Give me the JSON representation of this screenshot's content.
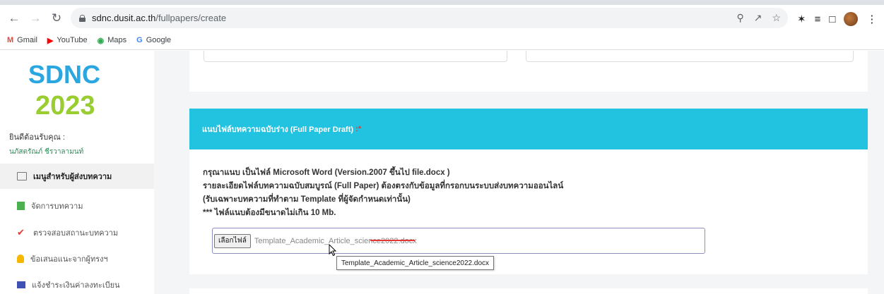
{
  "browser": {
    "url_domain": "sdnc.dusit.ac.th",
    "url_path": "/fullpapers/create",
    "bookmarks": [
      {
        "label": "Gmail",
        "icon": "gmail-icon"
      },
      {
        "label": "YouTube",
        "icon": "youtube-icon"
      },
      {
        "label": "Maps",
        "icon": "maps-icon"
      },
      {
        "label": "Google",
        "icon": "google-icon"
      }
    ]
  },
  "sidebar": {
    "logo_text_top": "SDNC",
    "logo_text_bottom": "2023",
    "welcome": "ยินดีต้อนรับคุณ :",
    "username": "นภัสตรัณภ์ ชีรวาลามนท์",
    "items": [
      {
        "label": "เมนูสำหรับผู้ส่งบทความ",
        "icon": "monitor-icon",
        "active": true
      },
      {
        "label": "จัดการบทความ",
        "icon": "document-icon",
        "active": false
      },
      {
        "label": "ตรวจสอบสถานะบทความ",
        "icon": "check-icon",
        "active": false
      },
      {
        "label": "ข้อเสนอแนะจากผู้ทรงฯ",
        "icon": "person-icon",
        "active": false
      },
      {
        "label": "แจ้งชำระเงินค่าลงทะเบียน",
        "icon": "cart-icon",
        "active": false
      }
    ]
  },
  "form": {
    "header": "แนบไฟล์บทความฉบับร่าง (Full Paper Draft)",
    "required_mark": ":*",
    "instructions": [
      "กรุณาแนบ เป็นไฟล์ Microsoft Word (Version.2007 ขึ้นไป file.docx )",
      "รายละเอียดไฟล์บทความฉบับสมบูรณ์ (Full Paper) ต้องตรงกับข้อมูลที่กรอกบนระบบส่งบทความออนไลน์",
      "(รับเฉพาะบทความที่ทำตาม Template ที่ผู้จัดกำหนดเท่านั้น)",
      "*** ไฟล์แนบต้องมีขนาดไม่เกิน 10 Mb."
    ],
    "choose_file_label": "เลือกไฟล์",
    "file_name": "Template_Academic_Article_science2022.docx",
    "tooltip": "Template_Academic_Article_science2022.docx"
  },
  "colors": {
    "header_bg": "#22c3e0",
    "underline": "#e53935"
  }
}
